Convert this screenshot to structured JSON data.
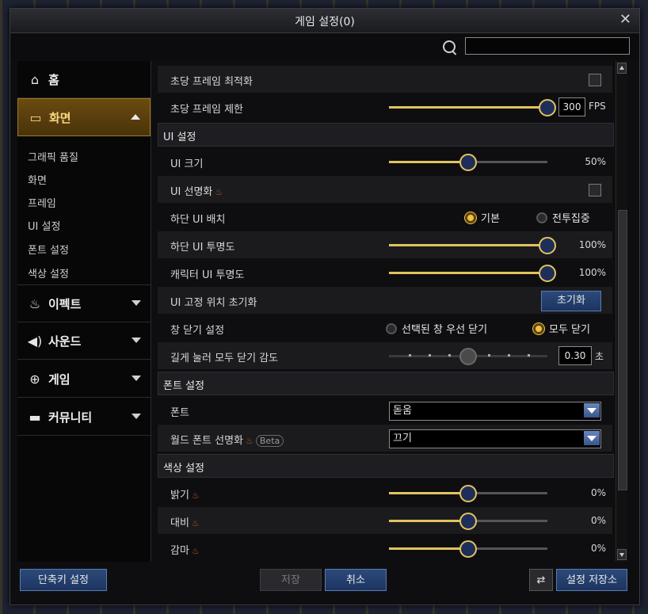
{
  "window": {
    "title": "게임 설정(0)"
  },
  "search": {
    "placeholder": "",
    "value": ""
  },
  "sidebar": {
    "categories": [
      {
        "label": "홈",
        "icon": "home-icon"
      },
      {
        "label": "화면",
        "icon": "monitor-icon"
      },
      {
        "label": "이펙트",
        "icon": "flame-icon"
      },
      {
        "label": "사운드",
        "icon": "speaker-icon"
      },
      {
        "label": "게임",
        "icon": "gamepad-icon"
      },
      {
        "label": "커뮤니티",
        "icon": "chat-icon"
      }
    ],
    "active_category": "화면",
    "subitems": [
      "그래픽 품질",
      "화면",
      "프레임",
      "UI 설정",
      "폰트 설정",
      "색상 설정"
    ]
  },
  "content": {
    "frame_opt": {
      "label": "초당 프레임 최적화",
      "checked": false
    },
    "frame_limit": {
      "label": "초당 프레임 제한",
      "value": "300",
      "unit": "FPS",
      "level": 1.0
    },
    "ui_section": "UI 설정",
    "ui_size": {
      "label": "UI 크기",
      "value": "50%",
      "level": 0.5
    },
    "ui_sharp": {
      "label": "UI 선명화",
      "checked": false
    },
    "bottom_ui": {
      "label": "하단 UI 배치",
      "options": [
        "기본",
        "전투집중"
      ],
      "selected": "기본"
    },
    "bottom_opacity": {
      "label": "하단 UI 투명도",
      "value": "100%",
      "level": 1.0
    },
    "char_opacity": {
      "label": "캐릭터 UI 투명도",
      "value": "100%",
      "level": 1.0
    },
    "ui_reset": {
      "label": "UI 고정 위치 초기화",
      "button": "초기화"
    },
    "close_setting": {
      "label": "창 닫기 설정",
      "options": [
        "선택된 창 우선 닫기",
        "모두 닫기"
      ],
      "selected": "모두 닫기"
    },
    "long_press": {
      "label": "길게 눌러 모두 닫기 감도",
      "value": "0.30",
      "unit": "초",
      "level": 0.5
    },
    "font_section": "폰트 설정",
    "font": {
      "label": "폰트",
      "selected": "돋움"
    },
    "world_font": {
      "label": "월드 폰트 선명화",
      "badge": "Beta",
      "selected": "끄기"
    },
    "color_section": "색상 설정",
    "brightness": {
      "label": "밝기",
      "value": "0%",
      "level": 0.5
    },
    "contrast": {
      "label": "대비",
      "value": "0%",
      "level": 0.5
    },
    "gamma": {
      "label": "감마",
      "value": "0%",
      "level": 0.5
    }
  },
  "footer": {
    "shortcut": "단축키 설정",
    "save": "저장",
    "cancel": "취소",
    "storage": "설정 저장소"
  },
  "colors": {
    "accent_gold": "#e2c35e",
    "button_blue": "#1d3460",
    "active_tab": "#6a4a10"
  }
}
